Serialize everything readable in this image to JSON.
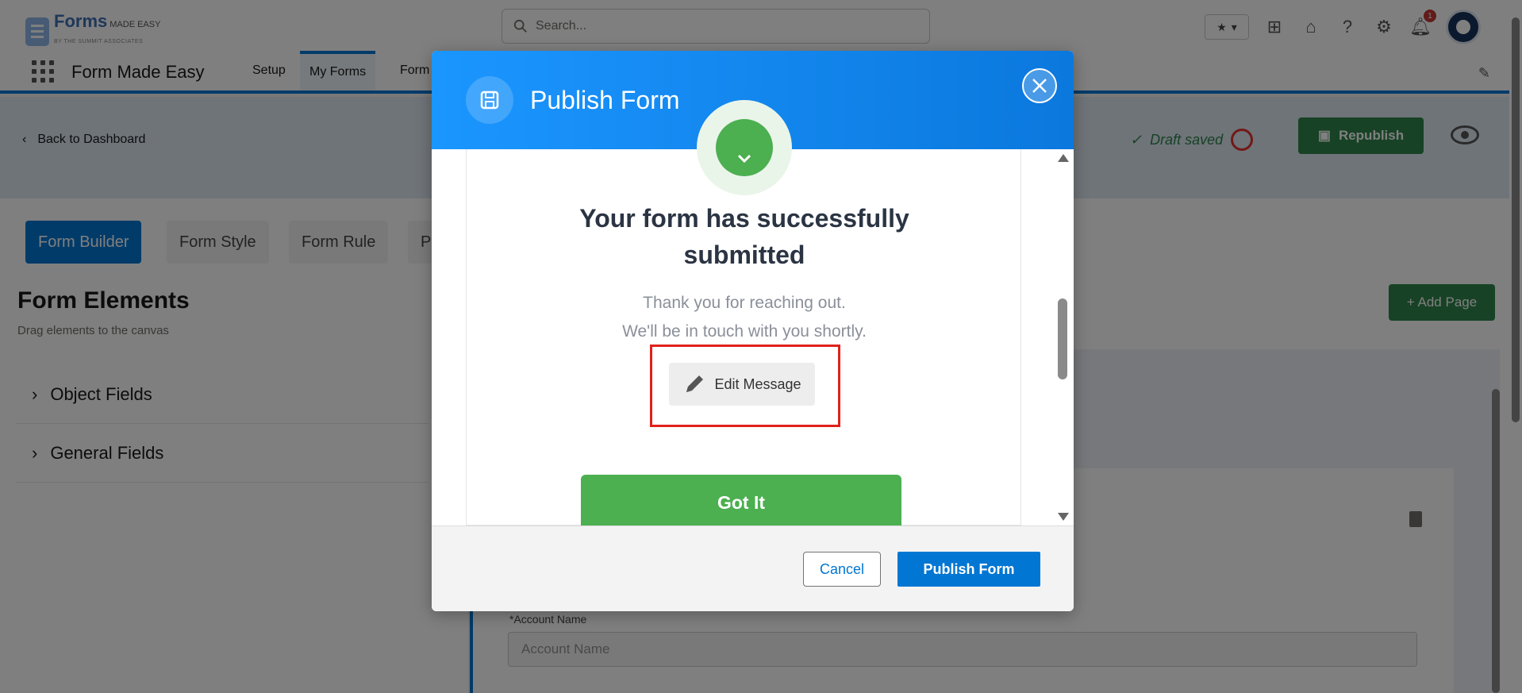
{
  "header": {
    "logo_text": "Forms",
    "logo_tagline": "MADE EASY",
    "logo_sub": "BY THE SUMMIT ASSOCIATES",
    "search_placeholder": "Search...",
    "notification_count": "1"
  },
  "nav": {
    "app_name": "Form Made Easy",
    "tabs": [
      {
        "label": "Setup"
      },
      {
        "label": "My Forms"
      },
      {
        "label": "Form"
      }
    ]
  },
  "builder": {
    "back_label": "Back to Dashboard",
    "draft_status": "Draft saved",
    "republish_label": "Republish",
    "tabs": [
      {
        "label": "Form Builder"
      },
      {
        "label": "Form Style"
      },
      {
        "label": "Form Rule"
      },
      {
        "label": "P"
      }
    ],
    "elements_title": "Form Elements",
    "elements_subtitle": "Drag elements to the canvas",
    "accordion": [
      {
        "label": "Object Fields"
      },
      {
        "label": "General Fields"
      }
    ],
    "add_page_label": "+ Add Page",
    "field_label": "*Account Name",
    "field_placeholder": "Account Name"
  },
  "modal": {
    "title": "Publish Form",
    "success_title_line1": "Your form has successfully",
    "success_title_line2": "submitted",
    "thank_line1": "Thank you for reaching out.",
    "thank_line2": "We'll be in touch with you shortly.",
    "edit_message_label": "Edit Message",
    "got_it_label": "Got It",
    "cancel_label": "Cancel",
    "publish_label": "Publish Form"
  },
  "colors": {
    "brand_blue": "#0176d3",
    "success_green": "#4caf50",
    "highlight_red": "#e0211b"
  }
}
